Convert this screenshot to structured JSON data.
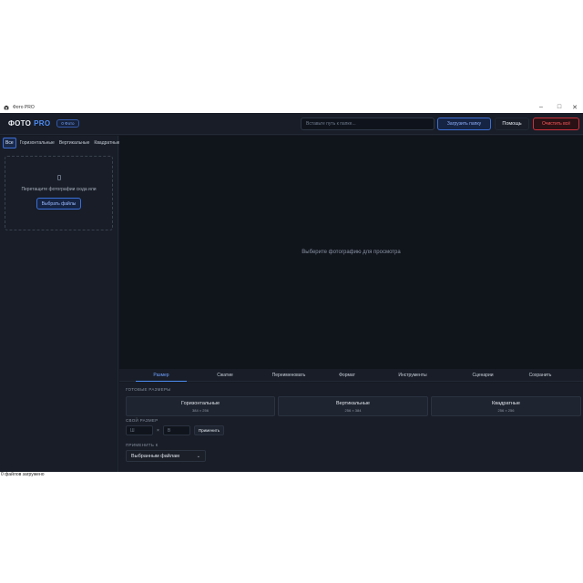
{
  "window": {
    "title": "Фото PRO",
    "app_icon": "camera-icon",
    "controls": {
      "minimize": "–",
      "maximize": "□",
      "close": "✕"
    }
  },
  "header": {
    "logo_main": "ФОТО",
    "logo_accent": "PRO",
    "badge": "0 Фото",
    "path_placeholder": "Вставьте путь к папке...",
    "load_button": "Загрузить папку",
    "help_button": "Помощь",
    "clear_button": "Очистить всё"
  },
  "sidebar": {
    "filters": [
      "Все",
      "Горизонтальные",
      "Вертикальные",
      "Квадратные"
    ],
    "active_filter": "Все",
    "dropzone_text": "Перетащите фотографии сюда или",
    "choose_button": "Выбрать файлы"
  },
  "preview": {
    "empty_text": "Выберите фотографию для просмотра"
  },
  "tabs": [
    "Размер",
    "Сжатие",
    "Переименовать",
    "Формат",
    "Инструменты",
    "Сценарии",
    "Сохранить"
  ],
  "active_tab": "Размер",
  "panel": {
    "presets_label": "ГОТОВЫЕ РАЗМЕРЫ",
    "presets": [
      {
        "name": "Горизонтальные",
        "size": "384 × 256"
      },
      {
        "name": "Вертикальные",
        "size": "256 × 384"
      },
      {
        "name": "Квадратные",
        "size": "256 × 256"
      }
    ],
    "custom_label": "СВОЙ РАЗМЕР",
    "width_placeholder": "Ш",
    "height_placeholder": "В",
    "times_symbol": "×",
    "apply_button": "Применить",
    "apply_to_label": "ПРИМЕНИТЬ К",
    "apply_to_value": "Выбранным файлам"
  },
  "status": {
    "text": "0 файлов загружено"
  },
  "colors": {
    "accent": "#4e8df5",
    "danger": "#c9303b",
    "background": "#151a23"
  }
}
